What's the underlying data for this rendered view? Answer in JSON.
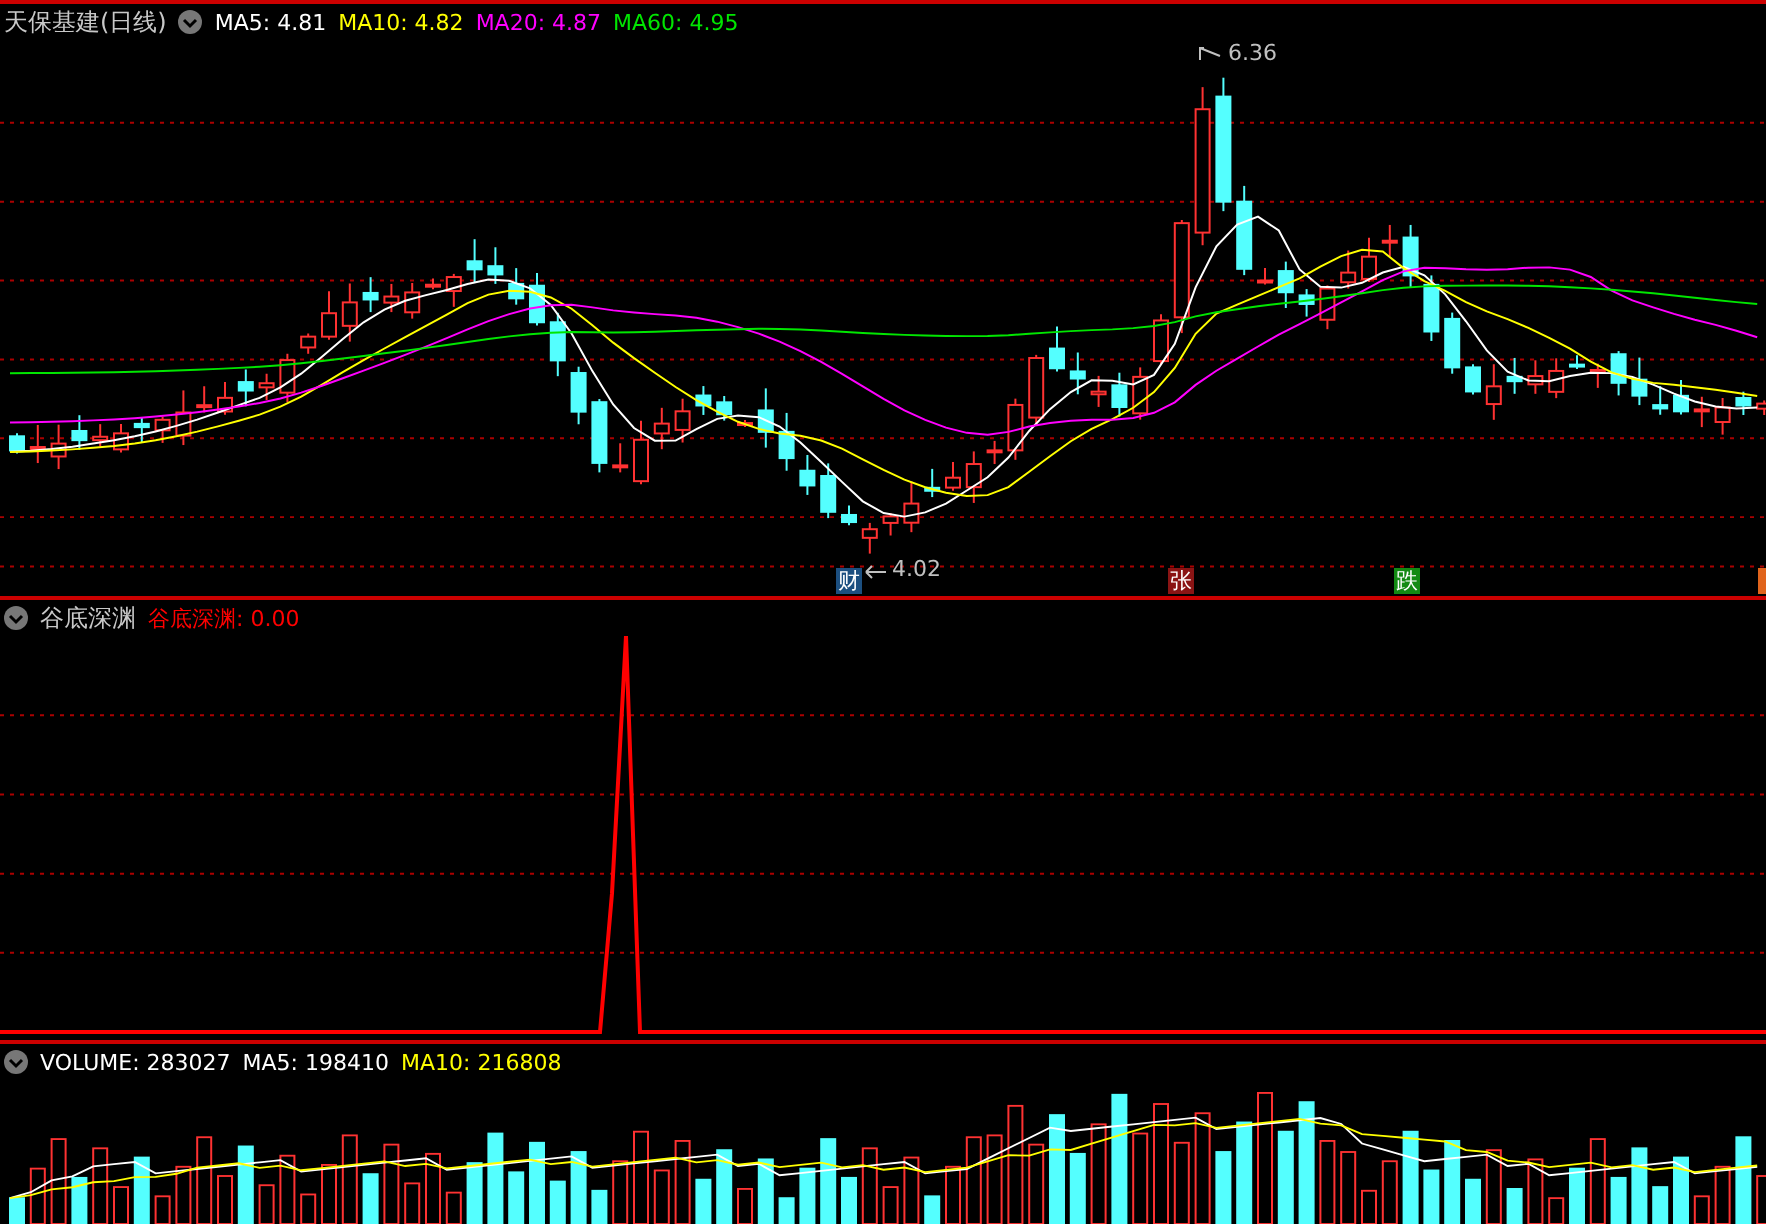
{
  "price_panel": {
    "title": "天保基建(日线)",
    "ma_items": [
      {
        "text": "MA5: 4.81",
        "color": "#ffffff"
      },
      {
        "text": "MA10: 4.82",
        "color": "#ffff00"
      },
      {
        "text": "MA20: 4.87",
        "color": "#ff00ff"
      },
      {
        "text": "MA60: 4.95",
        "color": "#00e600"
      }
    ],
    "high_label": "6.36",
    "low_label": "4.02",
    "events": [
      {
        "label": "财",
        "color": "#1c4f80"
      },
      {
        "label": "张",
        "color": "#8a1414"
      },
      {
        "label": "跌",
        "color": "#138a13"
      },
      {
        "color": "#e0641c"
      }
    ]
  },
  "indicator_panel": {
    "title": "谷底深渊",
    "value_text": "谷底深渊: 0.00",
    "color": "#ff0000"
  },
  "volume_panel": {
    "items": [
      {
        "text": "VOLUME: 283027",
        "color": "#ffffff"
      },
      {
        "text": "MA5: 198410",
        "color": "#ffffff"
      },
      {
        "text": "MA10: 216808",
        "color": "#ffff00"
      }
    ]
  }
}
